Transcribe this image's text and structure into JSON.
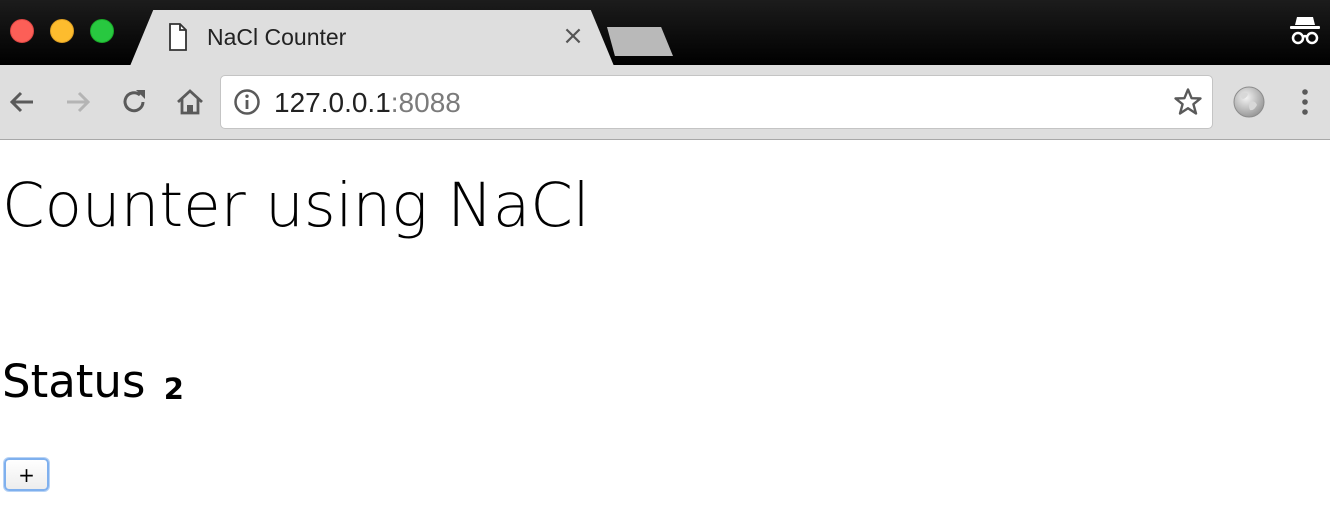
{
  "browser": {
    "tab": {
      "title": "NaCl Counter",
      "close_glyph": "×",
      "icon": "document-icon"
    },
    "url": {
      "host": "127.0.0.1",
      "port": ":8088"
    },
    "icons": {
      "back": "back-arrow-icon",
      "forward": "forward-arrow-icon",
      "reload": "reload-icon",
      "home": "home-icon",
      "info": "info-icon",
      "bookmark": "star-icon",
      "extension": "globe-icon",
      "menu": "kebab-menu-icon",
      "incognito": "incognito-icon"
    },
    "colors": {
      "close": "#fc5f57",
      "minimize": "#fdbc2e",
      "maximize": "#28c840",
      "tab_active": "#dedede",
      "focus_ring": "#7fb0ee"
    }
  },
  "page": {
    "title": "Counter using NaCl",
    "status_label": "Status",
    "status_value": "2",
    "increment_button_label": "+"
  }
}
